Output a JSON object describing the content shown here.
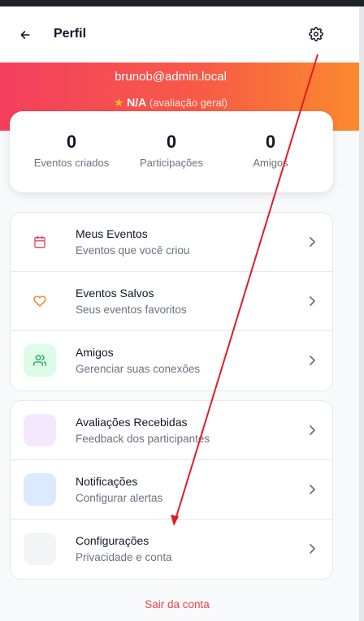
{
  "header": {
    "title": "Perfil",
    "back_icon": "arrow-left-icon",
    "settings_icon": "gear-icon"
  },
  "profile": {
    "email": "brunob@admin.local",
    "rating_value": "N/A",
    "rating_label": "(avaliação geral)"
  },
  "stats": [
    {
      "value": "0",
      "label": "Eventos criados"
    },
    {
      "value": "0",
      "label": "Participações"
    },
    {
      "value": "0",
      "label": "Amigos"
    }
  ],
  "menu_group_1": [
    {
      "title": "Meus Eventos",
      "subtitle": "Eventos que você criou",
      "icon": "calendar-icon"
    },
    {
      "title": "Eventos Salvos",
      "subtitle": "Seus eventos favoritos",
      "icon": "heart-icon"
    },
    {
      "title": "Amigos",
      "subtitle": "Gerenciar suas conexões",
      "icon": "users-icon"
    }
  ],
  "menu_group_2": [
    {
      "title": "Avaliações Recebidas",
      "subtitle": "Feedback dos participantes",
      "icon": "star-box-icon"
    },
    {
      "title": "Notificações",
      "subtitle": "Configurar alertas",
      "icon": "bell-box-icon"
    },
    {
      "title": "Configurações",
      "subtitle": "Privacidade e conta",
      "icon": "settings-box-icon"
    }
  ],
  "logout_label": "Sair da conta",
  "colors": {
    "accent": "#f43f5e",
    "gradient_end": "#fb8a2e",
    "annotation": "#e11d24"
  }
}
